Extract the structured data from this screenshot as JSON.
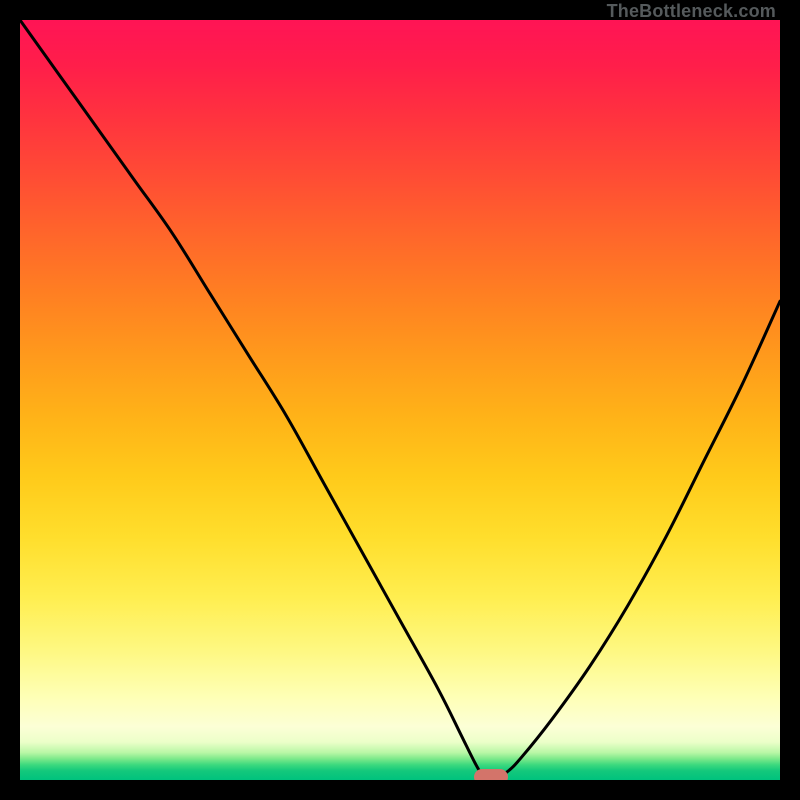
{
  "watermark": "TheBottleneck.com",
  "colors": {
    "frame": "#000000",
    "curve": "#000000",
    "marker": "#d3746a"
  },
  "chart_data": {
    "type": "line",
    "title": "",
    "xlabel": "",
    "ylabel": "",
    "xlim": [
      0,
      100
    ],
    "ylim": [
      0,
      100
    ],
    "grid": false,
    "legend": false,
    "series": [
      {
        "name": "bottleneck-curve",
        "x": [
          0,
          5,
          10,
          15,
          20,
          25,
          30,
          35,
          40,
          45,
          50,
          55,
          58,
          60,
          61,
          62,
          64,
          66,
          70,
          75,
          80,
          85,
          90,
          95,
          100
        ],
        "y": [
          100,
          93,
          86,
          79,
          72,
          64,
          56,
          48,
          39,
          30,
          21,
          12,
          6,
          2,
          0.5,
          0,
          1,
          3,
          8,
          15,
          23,
          32,
          42,
          52,
          63
        ]
      }
    ],
    "marker": {
      "x": 62,
      "y": 0
    },
    "background": "vertical-gradient red→green"
  }
}
